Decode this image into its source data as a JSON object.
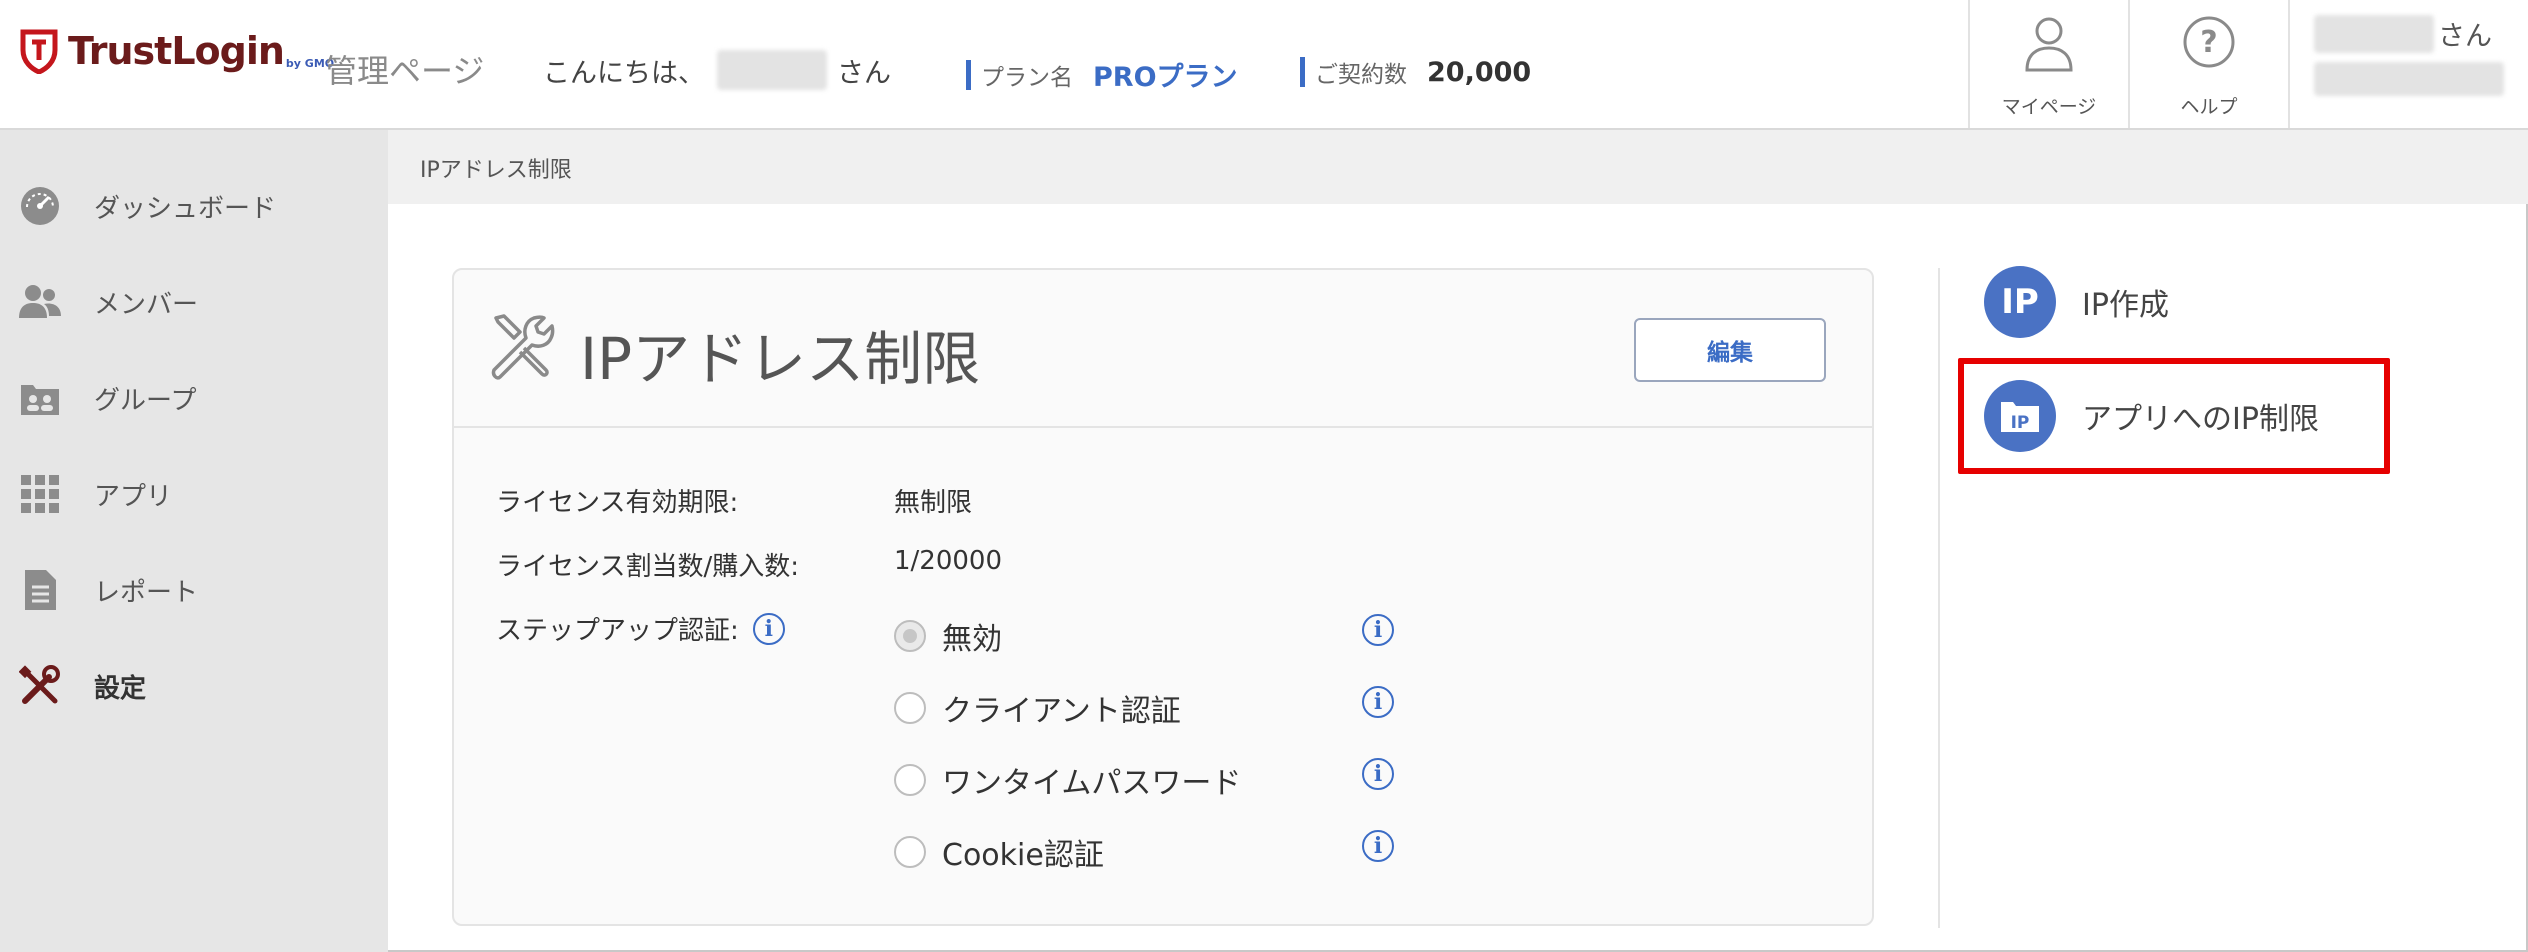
{
  "header": {
    "brand": "TrustLogin",
    "brand_sub": "by GMO",
    "admin_title": "管理ページ",
    "greeting_prefix": "こんにちは、",
    "greeting_suffix": "さん",
    "plan_label": "プラン名",
    "plan_value": "PROプラン",
    "contract_label": "ご契約数",
    "contract_value": "20,000",
    "mypage_label": "マイページ",
    "mypage_icon": "user-icon",
    "help_label": "ヘルプ",
    "help_icon": "help-icon",
    "user_suffix": "さん",
    "accent_color": "#3b6cc5",
    "brand_color": "#6b1b1b"
  },
  "sidebar": {
    "items": [
      {
        "label": "ダッシュボード",
        "icon": "dashboard-icon"
      },
      {
        "label": "メンバー",
        "icon": "members-icon"
      },
      {
        "label": "グループ",
        "icon": "group-icon"
      },
      {
        "label": "アプリ",
        "icon": "apps-grid-icon"
      },
      {
        "label": "レポート",
        "icon": "report-icon"
      },
      {
        "label": "設定",
        "icon": "settings-tools-icon",
        "active": true
      }
    ]
  },
  "breadcrumb": "IPアドレス制限",
  "card": {
    "title": "IPアドレス制限",
    "title_icon": "tools-icon",
    "edit_label": "編集",
    "fields": [
      {
        "label": "ライセンス有効期限:",
        "value": "無制限"
      },
      {
        "label": "ライセンス割当数/購入数:",
        "value": "1/20000"
      },
      {
        "label": "ステップアップ認証:"
      }
    ],
    "stepup_options": [
      {
        "label": "無効",
        "checked": true
      },
      {
        "label": "クライアント認証",
        "checked": false
      },
      {
        "label": "ワンタイムパスワード",
        "checked": false
      },
      {
        "label": "Cookie認証",
        "checked": false
      }
    ]
  },
  "actions": [
    {
      "label": "IP作成",
      "icon_text": "IP",
      "icon": "ip-create-icon"
    },
    {
      "label": "アプリへのIP制限",
      "icon_text": "IP",
      "icon": "app-ip-folder-icon",
      "highlighted": true
    }
  ],
  "highlight_color": "#e60000"
}
